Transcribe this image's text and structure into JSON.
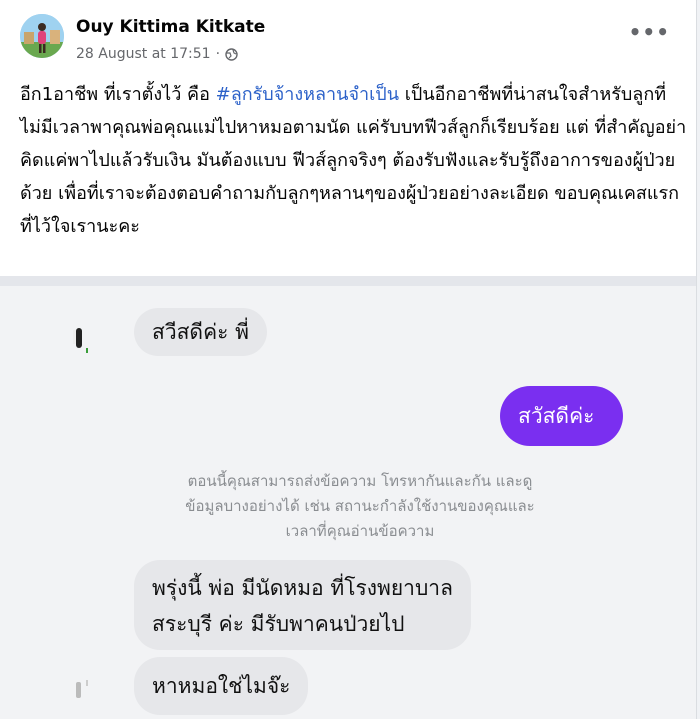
{
  "post": {
    "author": "Ouy Kittima Kitkate",
    "date": "28 August at 17:51",
    "separator": "·",
    "more_label": "•••",
    "text_before": "อีก1อาชีพ ที่เราตั้งไว้ คือ ",
    "hashtag": "#ลูกรับจ้างหลานจำเป็น",
    "text_after": " เป็นอีกอาชีพที่น่าสนใจสำหรับลูกที่ไม่มีเวลาพาคุณพ่อคุณแม่ไปหาหมอตามนัด แค่รับบทฟีวส์ลูกก็เรียบร้อย แต่ ที่สำคัญอย่าคิดแค่พาไปแล้วรับเงิน มันต้องแบบ ฟีวส์ลูกจริงๆ ต้องรับฟังและรับรู้ถึงอาการของผู้ป่วยด้วย เพื่อที่เราจะต้องตอบคำถามกับลูกๆหลานๆของผู้ป่วยอย่างละเอียด ขอบคุณเคสแรกที่ไว้ใจเรานะคะ"
  },
  "chat": {
    "msg1": "สวีสดีค่ะ พี่",
    "msg2": "สวัสดีค่ะ",
    "system_line1": "ตอนนี้คุณสามารถส่งข้อความ โทรหากันและกัน และดู",
    "system_line2": "ข้อมูลบางอย่างได้ เช่น สถานะกำลังใช้งานของคุณและ",
    "system_line3": "เวลาที่คุณอ่านข้อความ",
    "msg3_line1": "พรุ่งนี้ พ่อ มีนัดหมอ ที่โรงพยาบาล",
    "msg3_line2": "สระบุรี ค่ะ มีรับพาคนป่วยไป",
    "msg4": "หาหมอใช่ไมจ๊ะ"
  },
  "colors": {
    "accent": "#7a2ff0",
    "hashtag": "#2d62c9"
  },
  "icons": {
    "privacy": "globe-icon",
    "menu": "more-options-icon"
  }
}
